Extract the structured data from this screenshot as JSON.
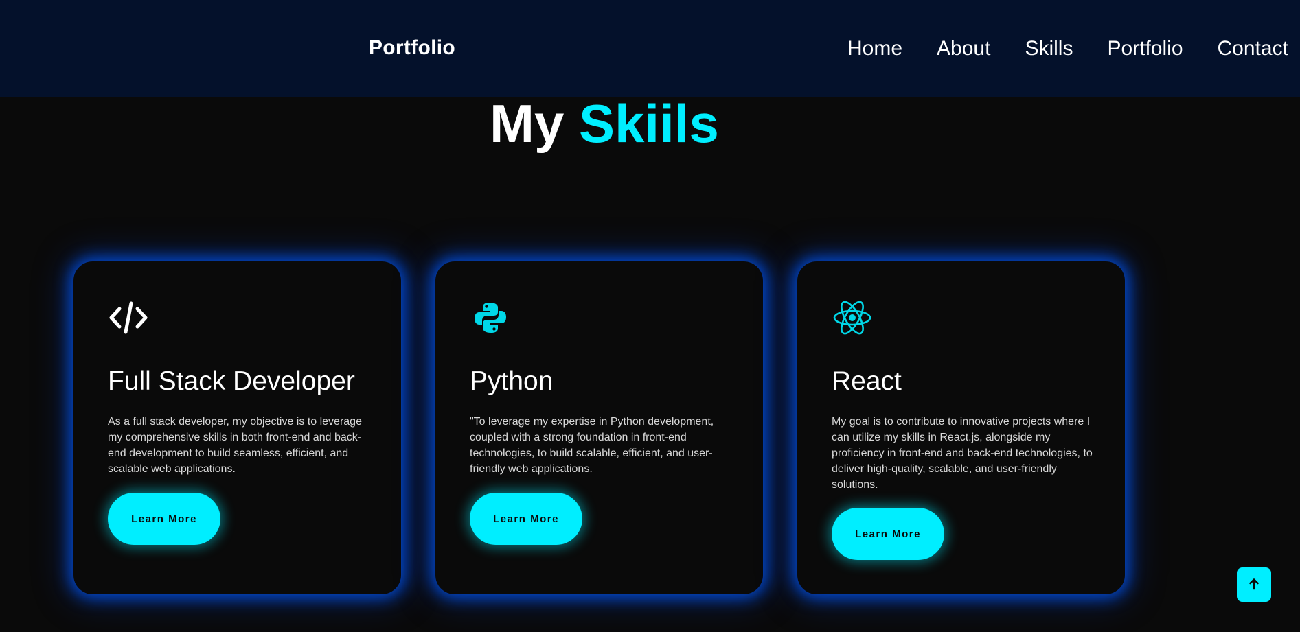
{
  "header": {
    "logo": "Portfolio",
    "nav": [
      {
        "label": "Home"
      },
      {
        "label": "About"
      },
      {
        "label": "Skills"
      },
      {
        "label": "Portfolio"
      },
      {
        "label": "Contact"
      }
    ]
  },
  "skills": {
    "title_main": "My",
    "title_accent": "Skiils",
    "cards": [
      {
        "icon": "code-icon",
        "title": "Full Stack Developer",
        "text": "As a full stack developer, my objective is to leverage my comprehensive skills in both front-end and back-end development to build seamless, efficient, and scalable web applications.",
        "button": "Learn More"
      },
      {
        "icon": "python-icon",
        "title": "Python",
        "text": "\"To leverage my expertise in Python development, coupled with a strong foundation in front-end technologies, to build scalable, efficient, and user-friendly web applications.",
        "button": "Learn More"
      },
      {
        "icon": "react-icon",
        "title": "React",
        "text": "My goal is to contribute to innovative projects where I can utilize my skills in React.js, alongside my proficiency in front-end and back-end technologies, to deliver high-quality, scalable, and user-friendly solutions.",
        "button": "Learn More"
      }
    ]
  },
  "scroll_top": {
    "icon": "arrow-up-icon"
  },
  "colors": {
    "accent": "#00eeff",
    "header_bg": "#04112b",
    "page_bg": "#0a0a0a",
    "card_glow": "#005aff"
  }
}
